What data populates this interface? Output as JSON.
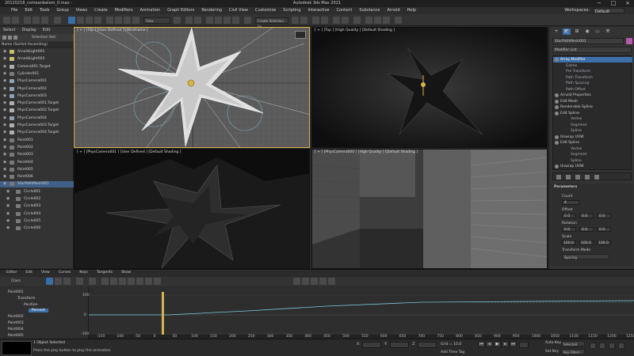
{
  "window": {
    "title": "Autodesk 3ds Max 2021",
    "file": "20120218_comeanbelem_0.max - ",
    "workspaces_label": "Workspaces:",
    "workspace_value": "Default"
  },
  "menu": [
    "File",
    "Edit",
    "Tools",
    "Group",
    "Views",
    "Create",
    "Modifiers",
    "Animation",
    "Graph Editors",
    "Rendering",
    "Civil View",
    "Customize",
    "Scripting",
    "Interactive",
    "Content",
    "Substance",
    "Arnold",
    "Help"
  ],
  "toolbar": {
    "view_dropdown": "View",
    "selection_set_placeholder": "Create Selection Se"
  },
  "scene_explorer": {
    "tabs": [
      "Select",
      "Display",
      "Edit"
    ],
    "header": "Selection Set:",
    "column_header": "Name (Sorted Ascending)",
    "items": [
      {
        "name": "ArnoldLight001",
        "kind": "light",
        "child": false
      },
      {
        "name": "ArnoldLight003",
        "kind": "light",
        "child": false
      },
      {
        "name": "Camera001.Target",
        "kind": "tgt",
        "child": false
      },
      {
        "name": "Cylinder001",
        "kind": "obj",
        "child": false
      },
      {
        "name": "PhysCamera001",
        "kind": "cam",
        "child": false
      },
      {
        "name": "PhysCamera002",
        "kind": "cam",
        "child": false
      },
      {
        "name": "PhysCamera003",
        "kind": "cam",
        "child": false
      },
      {
        "name": "PhysCamera001.Target",
        "kind": "tgt",
        "child": false
      },
      {
        "name": "PhysCamera002.Target",
        "kind": "tgt",
        "child": false
      },
      {
        "name": "PhysCamera004",
        "kind": "cam",
        "child": false
      },
      {
        "name": "PhysCamera003.Target",
        "kind": "tgt",
        "child": false
      },
      {
        "name": "PhysCamera004.Target",
        "kind": "tgt",
        "child": false
      },
      {
        "name": "Point001",
        "kind": "obj",
        "child": false
      },
      {
        "name": "Point002",
        "kind": "obj",
        "child": false
      },
      {
        "name": "Point003",
        "kind": "obj",
        "child": false
      },
      {
        "name": "Point004",
        "kind": "obj",
        "child": false
      },
      {
        "name": "Point005",
        "kind": "obj",
        "child": false
      },
      {
        "name": "Point006",
        "kind": "obj",
        "child": false
      },
      {
        "name": "StarPathMesh001",
        "kind": "obj",
        "child": false,
        "selected": true
      },
      {
        "name": "Circle001",
        "kind": "obj",
        "child": true
      },
      {
        "name": "Circle002",
        "kind": "obj",
        "child": true
      },
      {
        "name": "Circle003",
        "kind": "obj",
        "child": true
      },
      {
        "name": "Circle004",
        "kind": "obj",
        "child": true
      },
      {
        "name": "Circle005",
        "kind": "obj",
        "child": true
      },
      {
        "name": "Circle006",
        "kind": "obj",
        "child": true
      }
    ]
  },
  "viewports": {
    "top_left": "[ + ] [Top ] [User Defined ] [Wireframe ]",
    "top_right": "[ + ] [Top ] [High Quality ] [Default Shading ]",
    "bottom_left": "[ + ] [PhysCamera001 ] [User Defined ] [Default Shading ]",
    "bottom_right": "[ + ] [PhysCamera000 ] [High Quality ] [Default Shading ]"
  },
  "command_panel": {
    "object_name": "StarPathMesh001",
    "modifier_list": "Modifier List",
    "stack": [
      {
        "label": "Array Modifier",
        "level": "hd",
        "selected": true
      },
      {
        "label": "Gizmo",
        "level": "sub"
      },
      {
        "label": "Pre Transform",
        "level": "sub"
      },
      {
        "label": "Path Transform",
        "level": "sub"
      },
      {
        "label": "Path Spacing",
        "level": "sub"
      },
      {
        "label": "Path Offset",
        "level": "sub"
      },
      {
        "label": "Arnold Properties",
        "level": "hd"
      },
      {
        "label": "Edit Mesh",
        "level": "hd"
      },
      {
        "label": "Renderable Spline",
        "level": "hd"
      },
      {
        "label": "Edit Spline",
        "level": "hd"
      },
      {
        "label": "Vertex",
        "level": "sub2"
      },
      {
        "label": "Segment",
        "level": "sub2"
      },
      {
        "label": "Spline",
        "level": "sub2"
      },
      {
        "label": "Unwrap UVW",
        "level": "hd"
      },
      {
        "label": "Edit Spline",
        "level": "hd"
      },
      {
        "label": "Vertex",
        "level": "sub2"
      },
      {
        "label": "Segment",
        "level": "sub2"
      },
      {
        "label": "Spline",
        "level": "sub2"
      },
      {
        "label": "Unwrap UVW",
        "level": "hd"
      }
    ],
    "rollout_title": "Parameters",
    "count_label": "Count",
    "count_value": "4",
    "offset_label": "Offset",
    "offset_values": [
      "0.0",
      "0.0",
      "0.0"
    ],
    "rotation_label": "Rotation",
    "rotation_values": [
      "0.0",
      "0.0",
      "0.0"
    ],
    "scale_label": "Scale",
    "scale_values": [
      "100.0",
      "100.0",
      "100.0"
    ],
    "transform_mode_label": "Transform Mode",
    "transform_mode_value": "Spacing"
  },
  "trackview": {
    "menu": [
      "Editor",
      "Edit",
      "View",
      "Curves",
      "Keys",
      "Tangents",
      "Show"
    ],
    "filter_label": "Class",
    "tree": [
      {
        "label": "Point001",
        "indent": 10
      },
      {
        "label": "Transform",
        "indent": 22
      },
      {
        "label": "Position",
        "indent": 30
      },
      {
        "label": "Percent",
        "indent": 36,
        "selected": true
      },
      {
        "label": "Point002",
        "indent": 10
      },
      {
        "label": "Point003",
        "indent": 10
      },
      {
        "label": "Point004",
        "indent": 10
      },
      {
        "label": "Point005",
        "indent": 10
      },
      {
        "label": "Point006",
        "indent": 10
      }
    ],
    "y_labels": [
      "100",
      "0",
      "-100"
    ],
    "ruler_ticks": [
      "-150",
      "-100",
      "-50",
      "0",
      "50",
      "100",
      "150",
      "200",
      "250",
      "300",
      "350",
      "400",
      "450",
      "500",
      "550",
      "600",
      "650",
      "700",
      "750",
      "800",
      "850",
      "900",
      "950",
      "1000",
      "1050",
      "1100",
      "1150",
      "1200",
      "1250"
    ]
  },
  "status": {
    "selection": "1 Object Selected",
    "prompt": "Press the play button to play the animation",
    "x_label": "X:",
    "y_label": "Y:",
    "z_label": "Z:",
    "grid": "Grid = 10.0",
    "add_time_tag": "Add Time Tag",
    "autokey": "Auto Key",
    "selected": "Selected",
    "set_key": "Set Key",
    "key_filters": "Key Filters..."
  }
}
